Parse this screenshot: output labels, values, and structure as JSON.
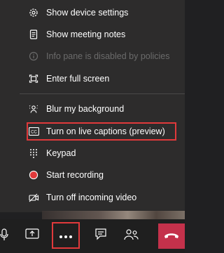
{
  "menu": {
    "items": [
      {
        "label": "Show device settings",
        "icon": "gear-icon"
      },
      {
        "label": "Show meeting notes",
        "icon": "notes-icon"
      },
      {
        "label": "Info pane is disabled by policies",
        "icon": "info-icon"
      },
      {
        "label": "Enter full screen",
        "icon": "fullscreen-icon"
      },
      {
        "label": "Blur my background",
        "icon": "blur-background-icon"
      },
      {
        "label": "Turn on live captions (preview)",
        "icon": "captions-icon"
      },
      {
        "label": "Keypad",
        "icon": "keypad-icon"
      },
      {
        "label": "Start recording",
        "icon": "record-icon"
      },
      {
        "label": "Turn off incoming video",
        "icon": "video-off-icon"
      }
    ]
  },
  "toolbar": {
    "buttons": [
      "mic-icon",
      "share-screen-icon",
      "more-options-icon",
      "chat-icon",
      "participants-icon",
      "hang-up-icon"
    ]
  },
  "colors": {
    "menu_bg": "#2d2c2c",
    "highlight": "#e0393b",
    "record_dot": "#e0393b",
    "hangup": "#c4314b"
  }
}
